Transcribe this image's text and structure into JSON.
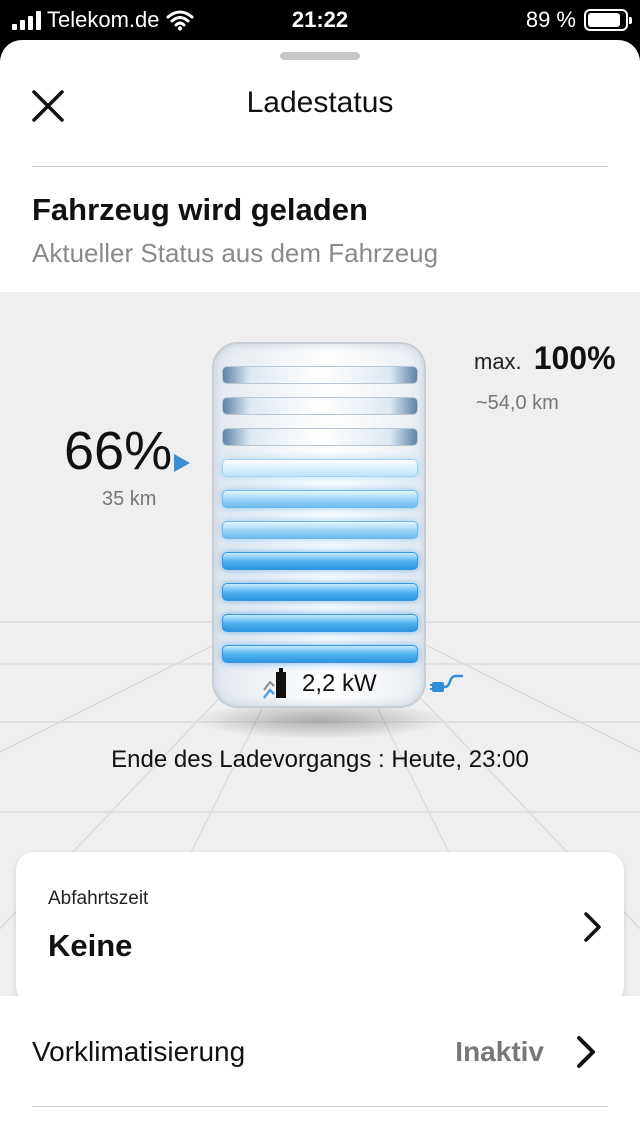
{
  "status_bar": {
    "carrier": "Telekom.de",
    "time": "21:22",
    "battery_percent": "89 %",
    "battery_level": 0.89
  },
  "header": {
    "title": "Ladestatus"
  },
  "status": {
    "title": "Fahrzeug wird geladen",
    "subtitle": "Aktueller Status aus dem Fahrzeug"
  },
  "charge": {
    "current_percent": "66%",
    "current_range": "35 km",
    "max_label": "max.",
    "max_percent": "100%",
    "max_range": "~54,0 km",
    "power": "2,2 kW",
    "end_text": "Ende des Ladevorgangs :  Heute, 23:00",
    "bars_total": 10,
    "bars_filled": 7
  },
  "departure": {
    "label": "Abfahrtszeit",
    "value": "Keine"
  },
  "preconditioning": {
    "label": "Vorklimatisierung",
    "value": "Inaktiv"
  },
  "colors": {
    "accent_blue": "#3a8fd0",
    "panel_gray": "#efefef"
  }
}
